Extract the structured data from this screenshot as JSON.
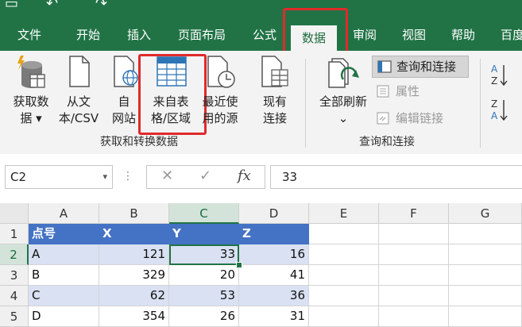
{
  "ribbon_tabs": [
    "文件",
    "开始",
    "插入",
    "页面布局",
    "公式",
    "数据",
    "审阅",
    "视图",
    "帮助",
    "百度"
  ],
  "active_tab": "数据",
  "ribbon": {
    "get_data": {
      "line1": "获取数",
      "line2": "据 ▾"
    },
    "from_text": {
      "line1": "从文",
      "line2": "本/CSV"
    },
    "from_web": {
      "line1": "自",
      "line2": "网站"
    },
    "from_table": {
      "line1": "来自表",
      "line2": "格/区域"
    },
    "recent_sources": {
      "line1": "最近使",
      "line2": "用的源"
    },
    "existing": {
      "line1": "现有",
      "line2": "连接"
    },
    "group1_label": "获取和转换数据",
    "refresh_all": {
      "line1": "全部刷新",
      "line2": "⌄"
    },
    "queries_connections": "查询和连接",
    "properties": "属性",
    "edit_links": "编辑链接",
    "group2_label": "查询和连接"
  },
  "formula_bar": {
    "name_box": "C2",
    "name_arrow": "▾",
    "dots": "⋮",
    "cancel": "✕",
    "enter": "✓",
    "fx": "fx",
    "value": "33"
  },
  "columns": [
    "A",
    "B",
    "C",
    "D",
    "E",
    "F",
    "G"
  ],
  "selected_col": "C",
  "rows": [
    "1",
    "2",
    "3",
    "4",
    "5"
  ],
  "selected_row": "2",
  "table": [
    [
      "点号",
      "X",
      "Y",
      "Z"
    ],
    [
      "A",
      "121",
      "33",
      "16"
    ],
    [
      "B",
      "329",
      "20",
      "41"
    ],
    [
      "C",
      "62",
      "53",
      "36"
    ],
    [
      "D",
      "354",
      "26",
      "31"
    ]
  ],
  "colors": {
    "accent": "#217346",
    "header_fill": "#4472c4",
    "band_fill": "#d9e1f2",
    "highlight": "#e02a2a"
  }
}
